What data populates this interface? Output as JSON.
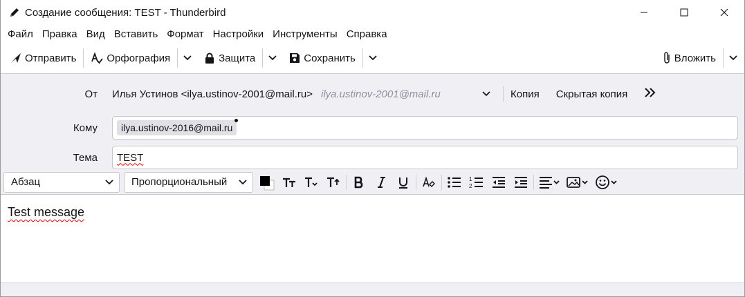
{
  "window": {
    "title": "Создание сообщения: TEST - Thunderbird"
  },
  "menu": [
    "Файл",
    "Правка",
    "Вид",
    "Вставить",
    "Формат",
    "Настройки",
    "Инструменты",
    "Справка"
  ],
  "toolbar": {
    "send_label": "Отправить",
    "spelling_label": "Орфография",
    "security_label": "Защита",
    "save_label": "Сохранить",
    "attach_label": "Вложить"
  },
  "header": {
    "from_label": "От",
    "from_value": "Илья Устинов <ilya.ustinov-2001@mail.ru>",
    "from_alt": "ilya.ustinov-2001@mail.ru",
    "cc_label": "Копия",
    "bcc_label": "Скрытая копия",
    "to_label": "Кому",
    "to_recipient": "ilya.ustinov-2016@mail.ru",
    "subject_label": "Тема",
    "subject_value": "TEST"
  },
  "format": {
    "paragraph_label": "Абзац",
    "font_label": "Пропорциональный"
  },
  "body": {
    "text": "Test message"
  },
  "colors": {
    "header_bg": "#f0f0f4",
    "spell_error": "#dd0000"
  }
}
